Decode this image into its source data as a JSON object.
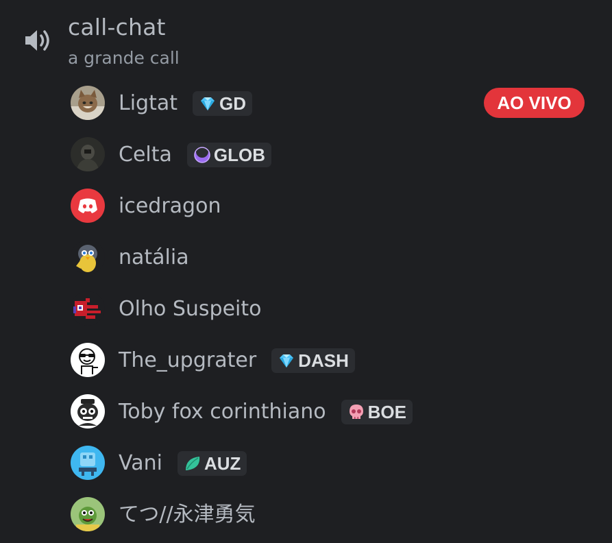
{
  "channel": {
    "name": "call-chat",
    "topic": "a grande call",
    "icon": "speaker-icon"
  },
  "users": [
    {
      "name": "Ligtat",
      "tag": {
        "label": "GD",
        "icon": "diamond-icon"
      },
      "live": "AO VIVO"
    },
    {
      "name": "Celta",
      "tag": {
        "label": "GLOB",
        "icon": "crescent-moon-icon"
      }
    },
    {
      "name": "icedragon"
    },
    {
      "name": "natália"
    },
    {
      "name": "Olho Suspeito"
    },
    {
      "name": "The_upgrater",
      "tag": {
        "label": "DASH",
        "icon": "diamond-icon"
      }
    },
    {
      "name": "Toby fox corinthiano",
      "tag": {
        "label": "BOE",
        "icon": "skull-icon"
      }
    },
    {
      "name": "Vani",
      "tag": {
        "label": "AUZ",
        "icon": "leaf-icon"
      }
    },
    {
      "name": "てつ//永津勇気"
    }
  ],
  "colors": {
    "background": "#1e1f22",
    "text": "#b5bac1",
    "live_badge": "#e3353b",
    "tag_background": "#2b2d31"
  }
}
